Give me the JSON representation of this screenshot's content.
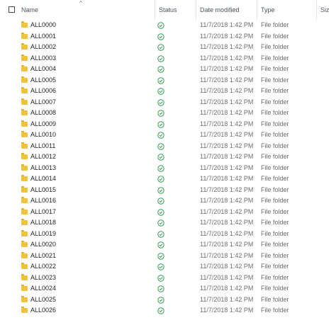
{
  "columns": {
    "name": "Name",
    "status": "Status",
    "date_modified": "Date modified",
    "type": "Type",
    "size": "Siz"
  },
  "sort_indicator": "^",
  "status_color": "#2e9e4f",
  "folder_color": "#f0c33c",
  "rows": [
    {
      "name": "ALL0000",
      "status": "synced-icon",
      "date": "11/7/2018 1:42 PM",
      "type": "File folder"
    },
    {
      "name": "ALL0001",
      "status": "synced-icon",
      "date": "11/7/2018 1:42 PM",
      "type": "File folder"
    },
    {
      "name": "ALL0002",
      "status": "synced-icon",
      "date": "11/7/2018 1:42 PM",
      "type": "File folder"
    },
    {
      "name": "ALL0003",
      "status": "synced-icon",
      "date": "11/7/2018 1:42 PM",
      "type": "File folder"
    },
    {
      "name": "ALL0004",
      "status": "synced-icon",
      "date": "11/7/2018 1:42 PM",
      "type": "File folder"
    },
    {
      "name": "ALL0005",
      "status": "synced-icon",
      "date": "11/7/2018 1:42 PM",
      "type": "File folder"
    },
    {
      "name": "ALL0006",
      "status": "synced-icon",
      "date": "11/7/2018 1:42 PM",
      "type": "File folder"
    },
    {
      "name": "ALL0007",
      "status": "synced-icon",
      "date": "11/7/2018 1:42 PM",
      "type": "File folder"
    },
    {
      "name": "ALL0008",
      "status": "synced-icon",
      "date": "11/7/2018 1:42 PM",
      "type": "File folder"
    },
    {
      "name": "ALL0009",
      "status": "synced-icon",
      "date": "11/7/2018 1:42 PM",
      "type": "File folder"
    },
    {
      "name": "ALL0010",
      "status": "synced-icon",
      "date": "11/7/2018 1:42 PM",
      "type": "File folder"
    },
    {
      "name": "ALL0011",
      "status": "synced-icon",
      "date": "11/7/2018 1:42 PM",
      "type": "File folder"
    },
    {
      "name": "ALL0012",
      "status": "synced-icon",
      "date": "11/7/2018 1:42 PM",
      "type": "File folder"
    },
    {
      "name": "ALL0013",
      "status": "synced-icon",
      "date": "11/7/2018 1:42 PM",
      "type": "File folder"
    },
    {
      "name": "ALL0014",
      "status": "synced-icon",
      "date": "11/7/2018 1:42 PM",
      "type": "File folder"
    },
    {
      "name": "ALL0015",
      "status": "synced-icon",
      "date": "11/7/2018 1:42 PM",
      "type": "File folder"
    },
    {
      "name": "ALL0016",
      "status": "synced-icon",
      "date": "11/7/2018 1:42 PM",
      "type": "File folder"
    },
    {
      "name": "ALL0017",
      "status": "synced-icon",
      "date": "11/7/2018 1:42 PM",
      "type": "File folder"
    },
    {
      "name": "ALL0018",
      "status": "synced-icon",
      "date": "11/7/2018 1:42 PM",
      "type": "File folder"
    },
    {
      "name": "ALL0019",
      "status": "synced-icon",
      "date": "11/7/2018 1:42 PM",
      "type": "File folder"
    },
    {
      "name": "ALL0020",
      "status": "synced-icon",
      "date": "11/7/2018 1:42 PM",
      "type": "File folder"
    },
    {
      "name": "ALL0021",
      "status": "synced-icon",
      "date": "11/7/2018 1:42 PM",
      "type": "File folder"
    },
    {
      "name": "ALL0022",
      "status": "synced-icon",
      "date": "11/7/2018 1:42 PM",
      "type": "File folder"
    },
    {
      "name": "ALL0023",
      "status": "synced-icon",
      "date": "11/7/2018 1:42 PM",
      "type": "File folder"
    },
    {
      "name": "ALL0024",
      "status": "synced-icon",
      "date": "11/7/2018 1:42 PM",
      "type": "File folder"
    },
    {
      "name": "ALL0025",
      "status": "synced-icon",
      "date": "11/7/2018 1:42 PM",
      "type": "File folder"
    },
    {
      "name": "ALL0026",
      "status": "synced-icon",
      "date": "11/7/2018 1:42 PM",
      "type": "File folder"
    }
  ]
}
